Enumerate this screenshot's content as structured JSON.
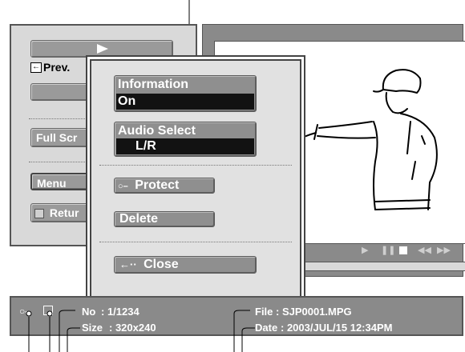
{
  "left_panel": {
    "play_icon": "play-icon",
    "prev_label": "Prev.",
    "full_screen_label": "Full Scr",
    "menu_label": "Menu",
    "return_label": "Retur"
  },
  "popup": {
    "information": {
      "title": "Information",
      "value": "On"
    },
    "audio_select": {
      "title": "Audio Select",
      "value": "L/R"
    },
    "protect_label": "Protect",
    "delete_label": "Delete",
    "close_label": "Close"
  },
  "status": {
    "no_label": "No",
    "no_value": ": 1/1234",
    "size_label": "Size",
    "size_value": ": 320x240",
    "file_label": "File",
    "file_value": ": SJP0001.MPG",
    "date_label": "Date",
    "date_value": ": 2003/JUL/15 12:34PM"
  },
  "colors": {
    "panel": "#d9d9d9",
    "button": "#9a9a9a",
    "value_bar": "#121212",
    "status_bar": "#8a8a8a"
  }
}
